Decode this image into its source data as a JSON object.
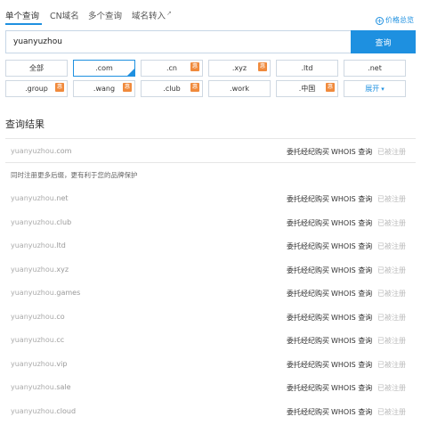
{
  "tabs": [
    {
      "label": "单个查询",
      "active": true
    },
    {
      "label": "CN域名",
      "active": false
    },
    {
      "label": "多个查询",
      "active": false
    },
    {
      "label": "域名转入",
      "active": false
    }
  ],
  "price_link": {
    "icon": "plus-circle-icon",
    "label": "价格总览"
  },
  "search": {
    "value": "yuanyuzhou",
    "button_label": "查询"
  },
  "suffixes": [
    {
      "label": "全部",
      "badge": "",
      "selected": false
    },
    {
      "label": ".com",
      "badge": "",
      "selected": true
    },
    {
      "label": ".cn",
      "badge": "惠",
      "selected": false
    },
    {
      "label": ".xyz",
      "badge": "惠",
      "selected": false
    },
    {
      "label": ".ltd",
      "badge": "",
      "selected": false
    },
    {
      "label": ".net",
      "badge": "",
      "selected": false
    },
    {
      "label": ".group",
      "badge": "惠",
      "selected": false
    },
    {
      "label": ".wang",
      "badge": "惠",
      "selected": false
    },
    {
      "label": ".club",
      "badge": "惠",
      "selected": false
    },
    {
      "label": ".work",
      "badge": "",
      "selected": false
    },
    {
      "label": ".中国",
      "badge": "惠",
      "selected": false
    },
    {
      "label": "展开",
      "badge": "",
      "selected": false
    }
  ],
  "results": {
    "title": "查询结果",
    "notice": "同时注册更多后缀，更有利于您的品牌保护",
    "agent_label": "委托经纪购买",
    "whois_label": "WHOIS 查询",
    "status_label": "已被注册",
    "rows": [
      {
        "name": "yuanyuzhou",
        "suffix": ".com"
      },
      {
        "name": "yuanyuzhou",
        "suffix": ".net"
      },
      {
        "name": "yuanyuzhou",
        "suffix": ".club"
      },
      {
        "name": "yuanyuzhou",
        "suffix": ".ltd"
      },
      {
        "name": "yuanyuzhou",
        "suffix": ".xyz"
      },
      {
        "name": "yuanyuzhou",
        "suffix": ".games"
      },
      {
        "name": "yuanyuzhou",
        "suffix": ".co"
      },
      {
        "name": "yuanyuzhou",
        "suffix": ".cc"
      },
      {
        "name": "yuanyuzhou",
        "suffix": ".vip"
      },
      {
        "name": "yuanyuzhou",
        "suffix": ".sale"
      },
      {
        "name": "yuanyuzhou",
        "suffix": ".cloud"
      }
    ]
  }
}
